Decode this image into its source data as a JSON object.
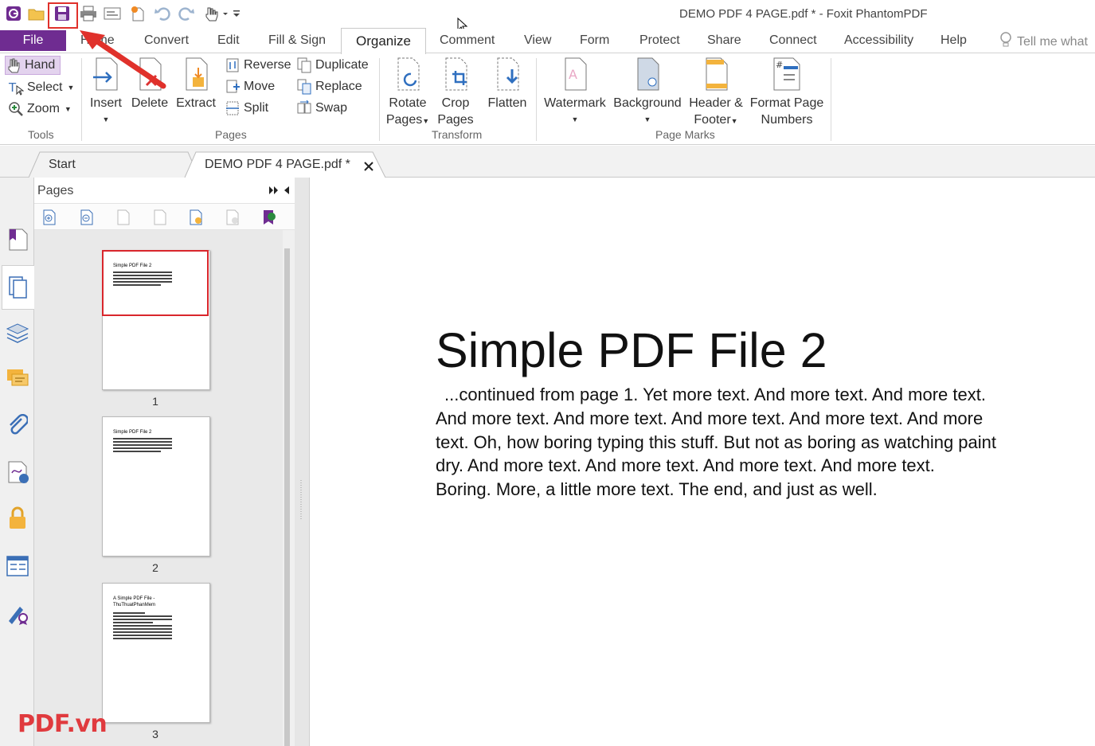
{
  "window": {
    "title": "DEMO PDF 4 PAGE.pdf * - Foxit PhantomPDF"
  },
  "quick_access": {
    "icons": [
      "app-logo-icon",
      "open-folder-icon",
      "save-icon",
      "print-icon",
      "screenshot-icon",
      "new-icon",
      "undo-icon",
      "redo-icon",
      "hand-select-icon",
      "customize-icon"
    ]
  },
  "ribbon_tabs": {
    "file": "File",
    "home": "Home",
    "convert": "Convert",
    "edit": "Edit",
    "fill_sign": "Fill & Sign",
    "organize": "Organize",
    "comment": "Comment",
    "view": "View",
    "form": "Form",
    "protect": "Protect",
    "share": "Share",
    "connect": "Connect",
    "accessibility": "Accessibility",
    "help": "Help",
    "tell_me": "Tell me what"
  },
  "ribbon": {
    "tools": {
      "hand": "Hand",
      "select": "Select",
      "zoom": "Zoom",
      "group": "Tools"
    },
    "pages": {
      "insert": "Insert",
      "delete": "Delete",
      "extract": "Extract",
      "reverse": "Reverse",
      "move": "Move",
      "split": "Split",
      "duplicate": "Duplicate",
      "replace": "Replace",
      "swap": "Swap",
      "group": "Pages"
    },
    "transform": {
      "rotate_1": "Rotate",
      "rotate_2": "Pages",
      "crop_1": "Crop",
      "crop_2": "Pages",
      "flatten": "Flatten",
      "group": "Transform"
    },
    "page_marks": {
      "watermark": "Watermark",
      "background": "Background",
      "header_1": "Header &",
      "header_2": "Footer",
      "format_1": "Format Page",
      "format_2": "Numbers",
      "group": "Page Marks"
    }
  },
  "doc_tabs": {
    "start": "Start",
    "current": "DEMO PDF 4 PAGE.pdf *"
  },
  "pages_panel": {
    "title": "Pages",
    "thumbnails": [
      {
        "number": "1",
        "title": "Simple PDF File 2"
      },
      {
        "number": "2",
        "title": "Simple PDF File 2"
      },
      {
        "number": "3",
        "title_1": "A Simple PDF File -",
        "title_2": "ThuThuatPhanMem"
      }
    ]
  },
  "document": {
    "title": "Simple PDF File 2",
    "lines": [
      " ...continued from page 1. Yet more text. And more text. And more text.",
      "And more text. And more text. And more text. And more text. And more",
      "text. Oh, how boring typing this stuff. But not as boring as watching  paint",
      "dry. And more text. And more text. And more text. And more text.",
      "Boring.  More, a little more text. The end, and just as well."
    ]
  },
  "watermark": "PDF.vn",
  "colors": {
    "brand": "#6f2c91",
    "highlight": "#e0312b",
    "watermark": "#e03a3e"
  }
}
